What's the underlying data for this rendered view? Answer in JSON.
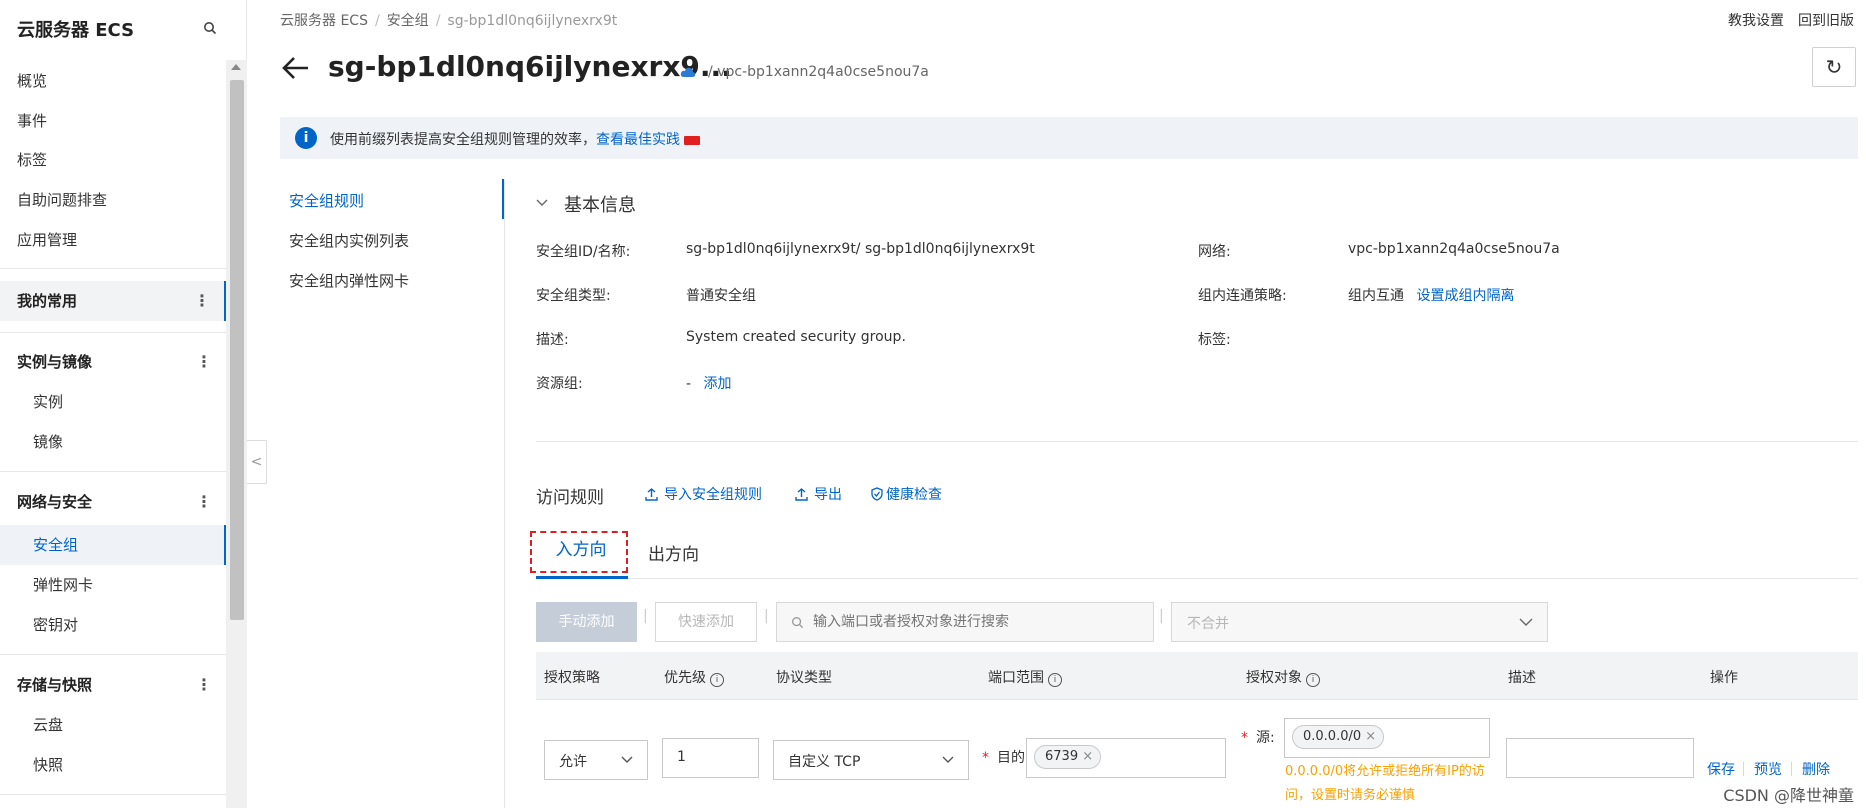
{
  "sidebar": {
    "title": "云服务器 ECS",
    "items": [
      {
        "label": "概览"
      },
      {
        "label": "事件"
      },
      {
        "label": "标签"
      },
      {
        "label": "自助问题排查"
      },
      {
        "label": "应用管理"
      }
    ],
    "groups": [
      {
        "label": "我的常用",
        "more": "⋮"
      },
      {
        "label": "实例与镜像",
        "more": "⋮",
        "children": [
          "实例",
          "镜像"
        ]
      },
      {
        "label": "网络与安全",
        "more": "⋮",
        "children": [
          "安全组",
          "弹性网卡",
          "密钥对"
        ]
      },
      {
        "label": "存储与快照",
        "more": "⋮",
        "children": [
          "云盘",
          "快照"
        ]
      }
    ]
  },
  "breadcrumb": [
    "云服务器 ECS",
    "安全组",
    "sg-bp1dl0nq6ijlynexrx9t"
  ],
  "breadcrumb_sep": "/",
  "top_links": [
    "教我设置",
    "回到旧版"
  ],
  "header": {
    "title": "sg-bp1dl0nq6ijlynexrx9...",
    "vpc": "/ vpc-bp1xann2q4a0cse5nou7a"
  },
  "banner": {
    "text": "使用前缀列表提高安全组规则管理的效率，",
    "link": "查看最佳实践",
    "icon": "i"
  },
  "subnav": [
    "安全组规则",
    "安全组内实例列表",
    "安全组内弹性网卡"
  ],
  "basic_info": {
    "title": "基本信息",
    "fields": {
      "id_label": "安全组ID/名称:",
      "id_value": "sg-bp1dl0nq6ijlynexrx9t/ sg-bp1dl0nq6ijlynexrx9t",
      "type_label": "安全组类型:",
      "type_value": "普通安全组",
      "desc_label": "描述:",
      "desc_value": "System created security group.",
      "rg_label": "资源组:",
      "rg_value": "-",
      "rg_link": "添加",
      "net_label": "网络:",
      "net_value": "vpc-bp1xann2q4a0cse5nou7a",
      "policy_label": "组内连通策略:",
      "policy_value": "组内互通",
      "policy_link": "设置成组内隔离",
      "tag_label": "标签:"
    }
  },
  "rules": {
    "title": "访问规则",
    "actions": [
      "导入安全组规则",
      "导出",
      "健康检查"
    ],
    "tabs": [
      "入方向",
      "出方向"
    ],
    "toolbar": {
      "manual_add": "手动添加",
      "quick_add": "快速添加",
      "sep": "|",
      "search_placeholder": "输入端口或者授权对象进行搜索",
      "merge_value": "不合并"
    },
    "columns": [
      "授权策略",
      "优先级",
      "协议类型",
      "端口范围",
      "授权对象",
      "描述",
      "操作"
    ],
    "info_glyph": "i",
    "row": {
      "policy": "允许",
      "priority": "1",
      "protocol": "自定义 TCP",
      "req_mark": "*",
      "port_label": "目的",
      "port_tag": "6739",
      "source_label": "源:",
      "source_tag": "0.0.0.0/0",
      "tag_close": "×",
      "warning": "0.0.0.0/0将允许或拒绝所有IP的访问，设置时请务必谨慎",
      "description": "",
      "ops": [
        "保存",
        "预览",
        "删除"
      ]
    }
  },
  "watermark": "CSDN @降世神童",
  "collapse_glyph": "<",
  "refresh_glyph": "↻",
  "colors": {
    "accent": "#0064c8",
    "warning": "#f7a000",
    "danger": "#e02020"
  }
}
